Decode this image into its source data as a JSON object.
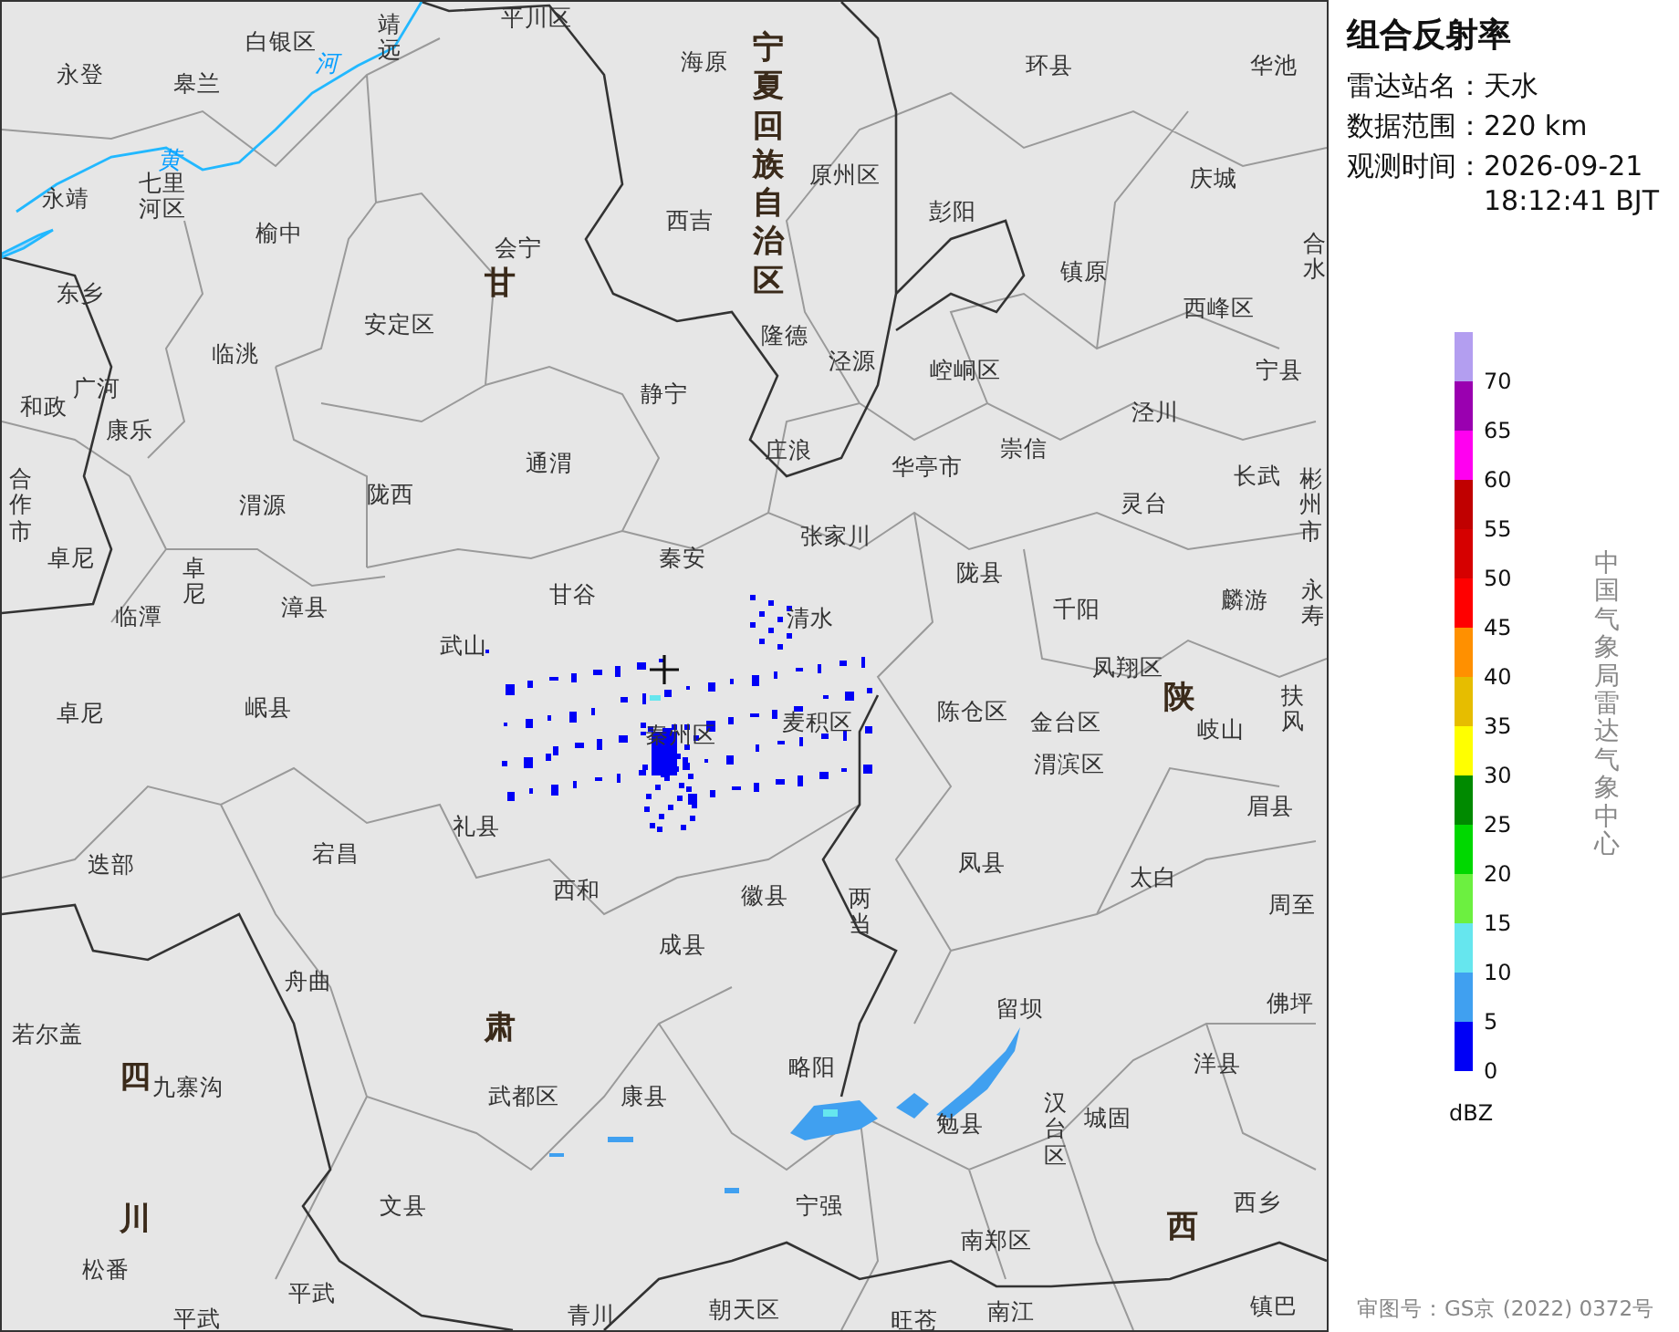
{
  "map": {
    "labels": [
      {
        "text": "白银区",
        "kind": "county"
      },
      {
        "text": "靖远",
        "kind": "county",
        "vertical": true
      },
      {
        "text": "平川区",
        "kind": "county"
      },
      {
        "text": "永登",
        "kind": "county"
      },
      {
        "text": "皋兰",
        "kind": "county"
      },
      {
        "text": "河",
        "kind": "river"
      },
      {
        "text": "海原",
        "kind": "county"
      },
      {
        "text": "环县",
        "kind": "county"
      },
      {
        "text": "华池",
        "kind": "county"
      },
      {
        "text": "黄",
        "kind": "river"
      },
      {
        "text": "宁夏回族自治区",
        "kind": "province",
        "vertical": true
      },
      {
        "text": "原州区",
        "kind": "county"
      },
      {
        "text": "庆城",
        "kind": "county"
      },
      {
        "text": "永靖",
        "kind": "county"
      },
      {
        "text": "七里河区",
        "kind": "county",
        "wrap": true
      },
      {
        "text": "西吉",
        "kind": "county"
      },
      {
        "text": "彭阳",
        "kind": "county"
      },
      {
        "text": "榆中",
        "kind": "county"
      },
      {
        "text": "会宁",
        "kind": "county"
      },
      {
        "text": "合水",
        "kind": "county",
        "vertical": true
      },
      {
        "text": "东乡",
        "kind": "county"
      },
      {
        "text": "甘",
        "kind": "province"
      },
      {
        "text": "镇原",
        "kind": "county"
      },
      {
        "text": "安定区",
        "kind": "county"
      },
      {
        "text": "隆德",
        "kind": "county"
      },
      {
        "text": "西峰区",
        "kind": "county"
      },
      {
        "text": "广河",
        "kind": "county"
      },
      {
        "text": "临洮",
        "kind": "county"
      },
      {
        "text": "静宁",
        "kind": "county"
      },
      {
        "text": "泾源",
        "kind": "county"
      },
      {
        "text": "崆峒区",
        "kind": "county"
      },
      {
        "text": "宁县",
        "kind": "county"
      },
      {
        "text": "和政",
        "kind": "county"
      },
      {
        "text": "康乐",
        "kind": "county"
      },
      {
        "text": "泾川",
        "kind": "county"
      },
      {
        "text": "通渭",
        "kind": "county"
      },
      {
        "text": "庄浪",
        "kind": "county"
      },
      {
        "text": "华亭市",
        "kind": "county"
      },
      {
        "text": "崇信",
        "kind": "county"
      },
      {
        "text": "合作市",
        "kind": "county",
        "vertical": true
      },
      {
        "text": "渭源",
        "kind": "county"
      },
      {
        "text": "陇西",
        "kind": "county"
      },
      {
        "text": "灵台",
        "kind": "county"
      },
      {
        "text": "长武",
        "kind": "county"
      },
      {
        "text": "彬州市",
        "kind": "county",
        "vertical": true
      },
      {
        "text": "卓尼",
        "kind": "county"
      },
      {
        "text": "秦安",
        "kind": "county"
      },
      {
        "text": "张家川",
        "kind": "county"
      },
      {
        "text": "临潭",
        "kind": "county"
      },
      {
        "text": "卓尼",
        "kind": "county",
        "vertical": true
      },
      {
        "text": "漳县",
        "kind": "county"
      },
      {
        "text": "甘谷",
        "kind": "county"
      },
      {
        "text": "清水",
        "kind": "county"
      },
      {
        "text": "陇县",
        "kind": "county"
      },
      {
        "text": "千阳",
        "kind": "county"
      },
      {
        "text": "麟游",
        "kind": "county"
      },
      {
        "text": "永寿",
        "kind": "county",
        "vertical": true
      },
      {
        "text": "武山",
        "kind": "county"
      },
      {
        "text": "凤翔区",
        "kind": "county"
      },
      {
        "text": "卓尼",
        "kind": "county"
      },
      {
        "text": "岷县",
        "kind": "county"
      },
      {
        "text": "秦州区",
        "kind": "county"
      },
      {
        "text": "麦积区",
        "kind": "county"
      },
      {
        "text": "陈仓区",
        "kind": "county"
      },
      {
        "text": "金台区",
        "kind": "county"
      },
      {
        "text": "陕",
        "kind": "province"
      },
      {
        "text": "岐山",
        "kind": "county"
      },
      {
        "text": "扶风",
        "kind": "county",
        "vertical": true
      },
      {
        "text": "渭滨区",
        "kind": "county"
      },
      {
        "text": "礼县",
        "kind": "county"
      },
      {
        "text": "眉县",
        "kind": "county"
      },
      {
        "text": "迭部",
        "kind": "county"
      },
      {
        "text": "宕昌",
        "kind": "county"
      },
      {
        "text": "西和",
        "kind": "county"
      },
      {
        "text": "徽县",
        "kind": "county"
      },
      {
        "text": "两当",
        "kind": "county",
        "vertical": true
      },
      {
        "text": "凤县",
        "kind": "county"
      },
      {
        "text": "太白",
        "kind": "county"
      },
      {
        "text": "周至",
        "kind": "county"
      },
      {
        "text": "成县",
        "kind": "county"
      },
      {
        "text": "若尔盖",
        "kind": "county"
      },
      {
        "text": "舟曲",
        "kind": "county"
      },
      {
        "text": "肃",
        "kind": "province"
      },
      {
        "text": "留坝",
        "kind": "county"
      },
      {
        "text": "佛坪",
        "kind": "county"
      },
      {
        "text": "四",
        "kind": "province"
      },
      {
        "text": "九寨沟",
        "kind": "county"
      },
      {
        "text": "武都区",
        "kind": "county"
      },
      {
        "text": "康县",
        "kind": "county"
      },
      {
        "text": "略阳",
        "kind": "county"
      },
      {
        "text": "洋县",
        "kind": "county"
      },
      {
        "text": "勉县",
        "kind": "county"
      },
      {
        "text": "汉台区",
        "kind": "county",
        "vertical": true
      },
      {
        "text": "城固",
        "kind": "county"
      },
      {
        "text": "川",
        "kind": "province"
      },
      {
        "text": "文县",
        "kind": "county"
      },
      {
        "text": "宁强",
        "kind": "county"
      },
      {
        "text": "南郑区",
        "kind": "county"
      },
      {
        "text": "西",
        "kind": "province"
      },
      {
        "text": "西乡",
        "kind": "county"
      },
      {
        "text": "松番",
        "kind": "county"
      },
      {
        "text": "平武",
        "kind": "county"
      },
      {
        "text": "平武",
        "kind": "county"
      },
      {
        "text": "青川",
        "kind": "county"
      },
      {
        "text": "朝天区",
        "kind": "county"
      },
      {
        "text": "旺苍",
        "kind": "county"
      },
      {
        "text": "南江",
        "kind": "county"
      },
      {
        "text": "镇巴",
        "kind": "county"
      }
    ]
  },
  "panel": {
    "title": "组合反射率",
    "fields": [
      {
        "label": "雷达站名：",
        "value": "天水"
      },
      {
        "label": "数据范围：",
        "value": "220 km"
      },
      {
        "label": "观测时间：",
        "value": "2026-09-21 18:12:41 BJT"
      }
    ],
    "legend": {
      "bins": [
        {
          "color": "#b39ef0",
          "label": "70"
        },
        {
          "color": "#9a00b0",
          "label": "65"
        },
        {
          "color": "#ff00f0",
          "label": "60"
        },
        {
          "color": "#c00000",
          "label": "55"
        },
        {
          "color": "#d60000",
          "label": "50"
        },
        {
          "color": "#ff0000",
          "label": "45"
        },
        {
          "color": "#ff9000",
          "label": "40"
        },
        {
          "color": "#e6bd00",
          "label": "35"
        },
        {
          "color": "#ffff00",
          "label": "30"
        },
        {
          "color": "#008a00",
          "label": "25"
        },
        {
          "color": "#00d800",
          "label": "20"
        },
        {
          "color": "#6cf040",
          "label": "15"
        },
        {
          "color": "#66e6ee",
          "label": "10"
        },
        {
          "color": "#40a0f0",
          "label": "5"
        },
        {
          "color": "#0000f6",
          "label": "0"
        }
      ],
      "unit": "dBZ"
    },
    "agency": "中国气象局雷达气象中心",
    "approval": "审图号：GS京 (2022) 0372号"
  }
}
